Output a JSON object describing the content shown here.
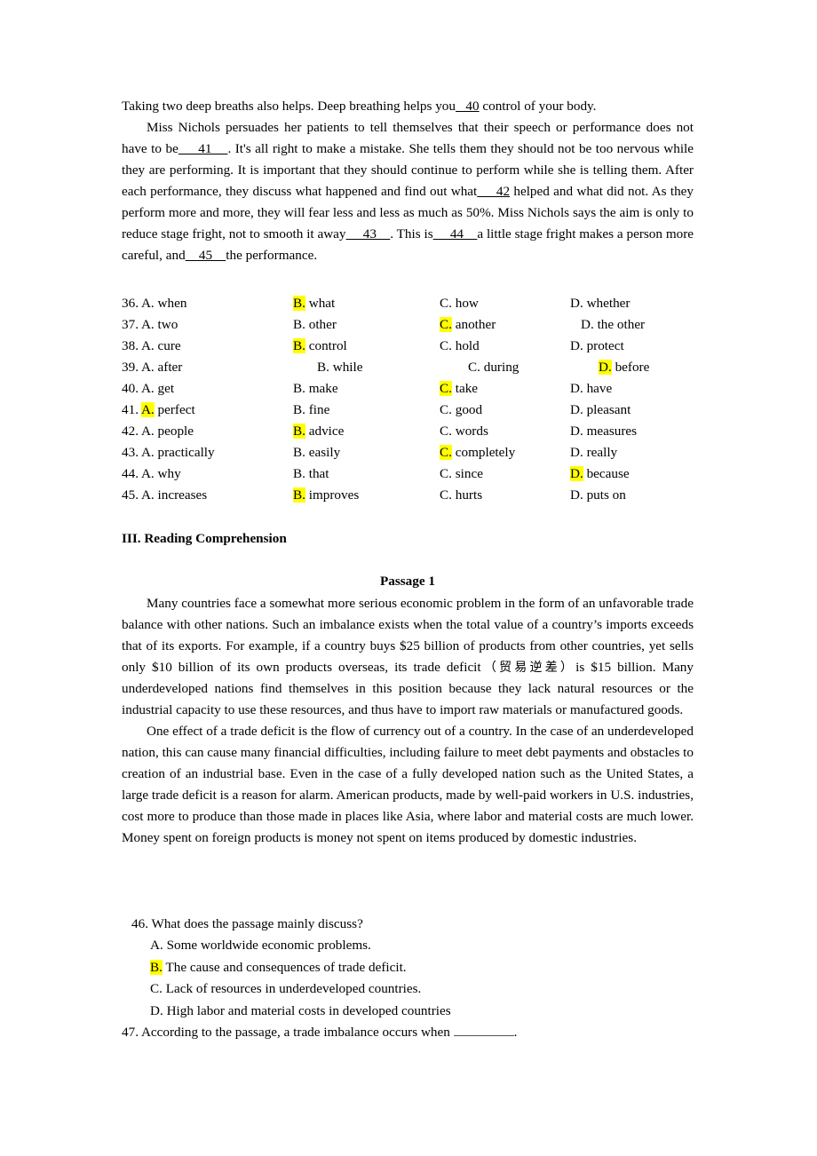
{
  "cloze_passage": {
    "line1_pre": "Taking two deep breaths also helps. Deep breathing helps you",
    "blank40": "   40",
    "line1_post": " control of your body.",
    "para2_pre": "Miss Nichols persuades her patients to tell themselves that their speech or performance does not have to be",
    "blank41": "     41    ",
    "para2_mid1": ". It's all right to make a mistake. She tells them they should not be too nervous while they are performing. It is important that they should continue to perform while she is telling them. After each performance, they discuss what happened and find out what",
    "blank42": "     42",
    "para2_mid2": " helped and what did not. As they perform more and more, they will fear less and less as much as 50%. Miss Nichols says the aim is only to reduce stage fright, not to smooth it away",
    "blank43": "     43    ",
    "para2_mid3": ". This is",
    "blank44": "     44    ",
    "para2_mid4": "a little stage fright makes a person more careful, and",
    "blank45": "    45    ",
    "para2_end": "the performance."
  },
  "options": {
    "highlight_color": "#ffff00",
    "rows": [
      {
        "number": "36.",
        "a": {
          "letter": "A.",
          "text": "when",
          "highlighted": false
        },
        "b": {
          "letter": "B.",
          "text": "what",
          "highlighted": true
        },
        "c": {
          "letter": "C.",
          "text": "how",
          "highlighted": false
        },
        "d": {
          "letter": "D.",
          "text": "whether",
          "highlighted": false
        }
      },
      {
        "number": "37.",
        "a": {
          "letter": "A.",
          "text": "two",
          "highlighted": false
        },
        "b": {
          "letter": "B.",
          "text": "other",
          "highlighted": false
        },
        "c": {
          "letter": "C.",
          "text": "another",
          "highlighted": true
        },
        "d": {
          "letter": "D.",
          "text": "the other",
          "highlighted": false
        }
      },
      {
        "number": "38.",
        "a": {
          "letter": "A.",
          "text": "cure",
          "highlighted": false
        },
        "b": {
          "letter": "B.",
          "text": "control",
          "highlighted": true
        },
        "c": {
          "letter": "C.",
          "text": "hold",
          "highlighted": false
        },
        "d": {
          "letter": "D.",
          "text": "protect",
          "highlighted": false
        }
      },
      {
        "number": "39.",
        "a": {
          "letter": "A.",
          "text": "after",
          "highlighted": false
        },
        "b": {
          "letter": "B.",
          "text": "while",
          "highlighted": false
        },
        "c": {
          "letter": "C.",
          "text": "during",
          "highlighted": false
        },
        "d": {
          "letter": "D.",
          "text": "before",
          "highlighted": true
        }
      },
      {
        "number": "40.",
        "a": {
          "letter": "A.",
          "text": "get",
          "highlighted": false
        },
        "b": {
          "letter": "B.",
          "text": "make",
          "highlighted": false
        },
        "c": {
          "letter": "C.",
          "text": "take",
          "highlighted": true
        },
        "d": {
          "letter": "D.",
          "text": "have",
          "highlighted": false
        }
      },
      {
        "number": "41.",
        "a": {
          "letter": "A.",
          "text": "perfect",
          "highlighted": true
        },
        "b": {
          "letter": "B.",
          "text": "fine",
          "highlighted": false
        },
        "c": {
          "letter": "C.",
          "text": "good",
          "highlighted": false
        },
        "d": {
          "letter": "D.",
          "text": "pleasant",
          "highlighted": false
        }
      },
      {
        "number": "42.",
        "a": {
          "letter": "A.",
          "text": "people",
          "highlighted": false
        },
        "b": {
          "letter": "B.",
          "text": "advice",
          "highlighted": true
        },
        "c": {
          "letter": "C.",
          "text": "words",
          "highlighted": false
        },
        "d": {
          "letter": "D.",
          "text": "measures",
          "highlighted": false
        }
      },
      {
        "number": "43.",
        "a": {
          "letter": "A.",
          "text": "practically",
          "highlighted": false
        },
        "b": {
          "letter": "B.",
          "text": "easily",
          "highlighted": false
        },
        "c": {
          "letter": "C.",
          "text": "completely",
          "highlighted": true
        },
        "d": {
          "letter": "D.",
          "text": "really",
          "highlighted": false
        }
      },
      {
        "number": "44.",
        "a": {
          "letter": "A.",
          "text": "why",
          "highlighted": false
        },
        "b": {
          "letter": "B.",
          "text": "that",
          "highlighted": false
        },
        "c": {
          "letter": "C.",
          "text": "since",
          "highlighted": false
        },
        "d": {
          "letter": "D.",
          "text": "because",
          "highlighted": true
        }
      },
      {
        "number": "45.",
        "a": {
          "letter": "A.",
          "text": "increases",
          "highlighted": false
        },
        "b": {
          "letter": "B.",
          "text": "improves",
          "highlighted": true
        },
        "c": {
          "letter": "C.",
          "text": "hurts",
          "highlighted": false
        },
        "d": {
          "letter": "D.",
          "text": "puts on",
          "highlighted": false
        }
      }
    ]
  },
  "section_heading": "III. Reading Comprehension",
  "passage_title": "Passage 1",
  "reading_passage": {
    "para1_part1": "Many countries face a somewhat more serious economic problem in the form of an unfavorable trade balance with other nations. Such an imbalance exists when the total value of a country’s imports exceeds that of its exports. For example, if a country buys $25 billion of products from other countries, yet sells only $10 billion of its own products overseas, its trade deficit",
    "para1_chinese": "（贸易逆差）",
    "para1_part2": "is $15 billion. Many underdeveloped nations find themselves in this position because they lack natural resources or the industrial capacity to use these resources, and thus have to import raw materials or manufactured goods.",
    "para2": "One effect of a trade deficit is the flow of currency out of a country. In the case of an underdeveloped nation, this can cause many financial difficulties, including failure to meet debt payments and obstacles to creation of an industrial base. Even in the case of a fully developed nation such as the United States, a large trade deficit is a reason for alarm. American products, made by well-paid workers in U.S. industries, cost more to produce than those made in places like Asia, where labor and material costs are much lower. Money spent on foreign products is money not spent on items produced by domestic industries."
  },
  "questions": [
    {
      "number": "46.",
      "stem": "46. What does the passage mainly discuss?",
      "choices": [
        {
          "letter": "A.",
          "text": "Some worldwide economic problems.",
          "highlighted": false
        },
        {
          "letter": "B.",
          "text": "The cause and consequences of trade deficit.",
          "highlighted": true
        },
        {
          "letter": "C.",
          "text": "Lack of resources in underdeveloped countries.",
          "highlighted": false
        },
        {
          "letter": "D.",
          "text": "High labor and material costs in developed countries",
          "highlighted": false
        }
      ]
    },
    {
      "number": "47.",
      "stem_pre": "47. According to the passage, a trade imbalance occurs when ",
      "stem_post": "."
    }
  ]
}
